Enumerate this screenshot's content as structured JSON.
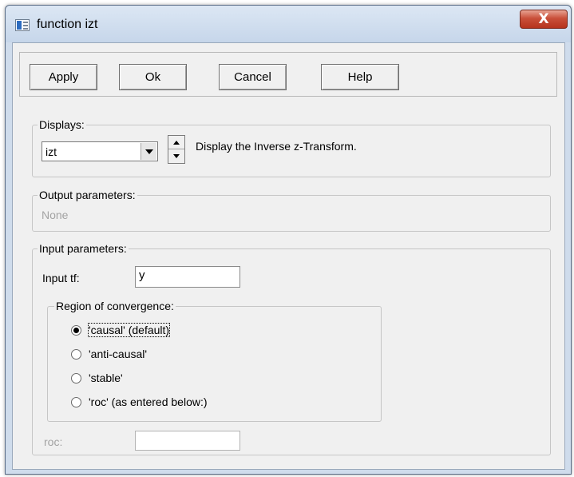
{
  "window": {
    "title": "function izt",
    "close_glyph": "X"
  },
  "buttons": {
    "apply": "Apply",
    "ok": "Ok",
    "cancel": "Cancel",
    "help": "Help"
  },
  "displays": {
    "label": "Displays:",
    "selected": "izt",
    "description": "Display the Inverse z-Transform."
  },
  "output_parameters": {
    "label": "Output parameters:",
    "value": "None"
  },
  "input_parameters": {
    "label": "Input parameters:",
    "input_tf_label": "Input tf:",
    "input_tf_value": "y",
    "roc_label": "roc:",
    "roc_value": ""
  },
  "region_of_convergence": {
    "label": "Region of convergence:",
    "options": [
      {
        "label": "'causal' (default)",
        "checked": true
      },
      {
        "label": "'anti-causal'",
        "checked": false
      },
      {
        "label": "'stable'",
        "checked": false
      },
      {
        "label": "'roc' (as entered below:)",
        "checked": false
      }
    ]
  },
  "colors": {
    "frame": "#cfdcec",
    "close_button": "#c9503a",
    "dialog_background": "#f0f0f0",
    "disabled_text": "#a3a3a3"
  },
  "icons": [
    "app-window-icon",
    "close-icon",
    "dropdown-arrow-icon",
    "spin-up-icon",
    "spin-down-icon"
  ]
}
